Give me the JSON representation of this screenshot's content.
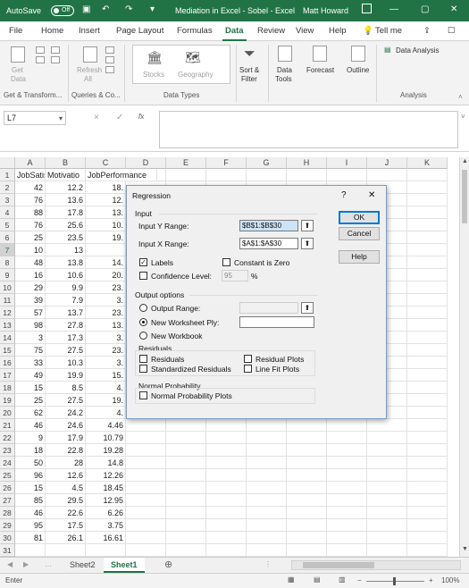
{
  "titlebar": {
    "autosave_label": "AutoSave",
    "autosave_state": "Off",
    "title": "Mediation in Excel - Sobel  -  Excel",
    "user": "Matt Howard",
    "tell_me": "Tell me"
  },
  "tabs": [
    "File",
    "Home",
    "Insert",
    "Page Layout",
    "Formulas",
    "Data",
    "Review",
    "View",
    "Help"
  ],
  "active_tab": "Data",
  "ribbon": {
    "get_data": "Get",
    "get_data2": "Data",
    "refresh": "Refresh",
    "refresh2": "All",
    "stocks": "Stocks",
    "geography": "Geography",
    "sort_filter": "Sort &",
    "sort_filter2": "Filter",
    "data_tools": "Data",
    "data_tools2": "Tools",
    "forecast": "Forecast",
    "outline": "Outline",
    "data_analysis": "Data Analysis",
    "groups": [
      "Get & Transform...",
      "Queries & Co...",
      "Data Types",
      "Analysis"
    ]
  },
  "formula_bar": {
    "name_box": "L7",
    "fx": "fx",
    "cancel": "×",
    "enter": "✓"
  },
  "columns": [
    "A",
    "B",
    "C",
    "D",
    "E",
    "F",
    "G",
    "H",
    "I",
    "J",
    "K"
  ],
  "header_row": [
    "JobSatisfa",
    "Motivatio",
    "JobPerformance"
  ],
  "rows": [
    [
      "42",
      "12.2",
      "18."
    ],
    [
      "76",
      "13.6",
      "12."
    ],
    [
      "88",
      "17.8",
      "13."
    ],
    [
      "76",
      "25.6",
      "10."
    ],
    [
      "25",
      "23.5",
      "19."
    ],
    [
      "10",
      "13",
      ""
    ],
    [
      "48",
      "13.8",
      "14."
    ],
    [
      "16",
      "10.6",
      "20."
    ],
    [
      "29",
      "9.9",
      "23."
    ],
    [
      "39",
      "7.9",
      "3."
    ],
    [
      "57",
      "13.7",
      "23."
    ],
    [
      "98",
      "27.8",
      "13."
    ],
    [
      "3",
      "17.3",
      "3."
    ],
    [
      "75",
      "27.5",
      "23."
    ],
    [
      "33",
      "10.3",
      "3."
    ],
    [
      "49",
      "19.9",
      "15."
    ],
    [
      "15",
      "8.5",
      "4."
    ],
    [
      "25",
      "27.5",
      "19."
    ],
    [
      "62",
      "24.2",
      "4."
    ],
    [
      "46",
      "24.6",
      "4.46"
    ],
    [
      "9",
      "17.9",
      "10.79"
    ],
    [
      "18",
      "22.8",
      "19.28"
    ],
    [
      "50",
      "28",
      "14.8"
    ],
    [
      "96",
      "12.6",
      "12.26"
    ],
    [
      "15",
      "4.5",
      "18.45"
    ],
    [
      "85",
      "29.5",
      "12.95"
    ],
    [
      "46",
      "22.6",
      "6.26"
    ],
    [
      "95",
      "17.5",
      "3.75"
    ],
    [
      "81",
      "26.1",
      "16.61"
    ]
  ],
  "selected_row": "7",
  "sheets": [
    "Sheet2",
    "Sheet1"
  ],
  "active_sheet": "Sheet1",
  "status": {
    "mode": "Enter",
    "zoom": "100%",
    "zoom_minus": "−",
    "zoom_plus": "+"
  },
  "dialog": {
    "title": "Regression",
    "help_q": "?",
    "close": "✕",
    "input_section": "Input",
    "input_y_label": "Input Y Range:",
    "input_y_value": "$B$1:$B$30",
    "input_x_label": "Input X Range:",
    "input_x_value": "$A$1:$A$30",
    "labels": "Labels",
    "constant_zero": "Constant is Zero",
    "confidence": "Confidence Level:",
    "confidence_value": "95",
    "percent": "%",
    "output_section": "Output options",
    "output_range": "Output Range:",
    "new_ply": "New Worksheet Ply:",
    "new_workbook": "New Workbook",
    "residuals_section": "Residuals",
    "residuals": "Residuals",
    "residual_plots": "Residual Plots",
    "std_residuals": "Standardized Residuals",
    "line_fit": "Line Fit Plots",
    "normal_section": "Normal Probability",
    "normal_plots": "Normal Probability Plots",
    "ok": "OK",
    "cancel": "Cancel",
    "help": "Help",
    "collapse_glyph": "⬆"
  },
  "colors": {
    "excel_green": "#217346",
    "dialog_border": "#7d9ec0",
    "default_button": "#0078d7"
  }
}
